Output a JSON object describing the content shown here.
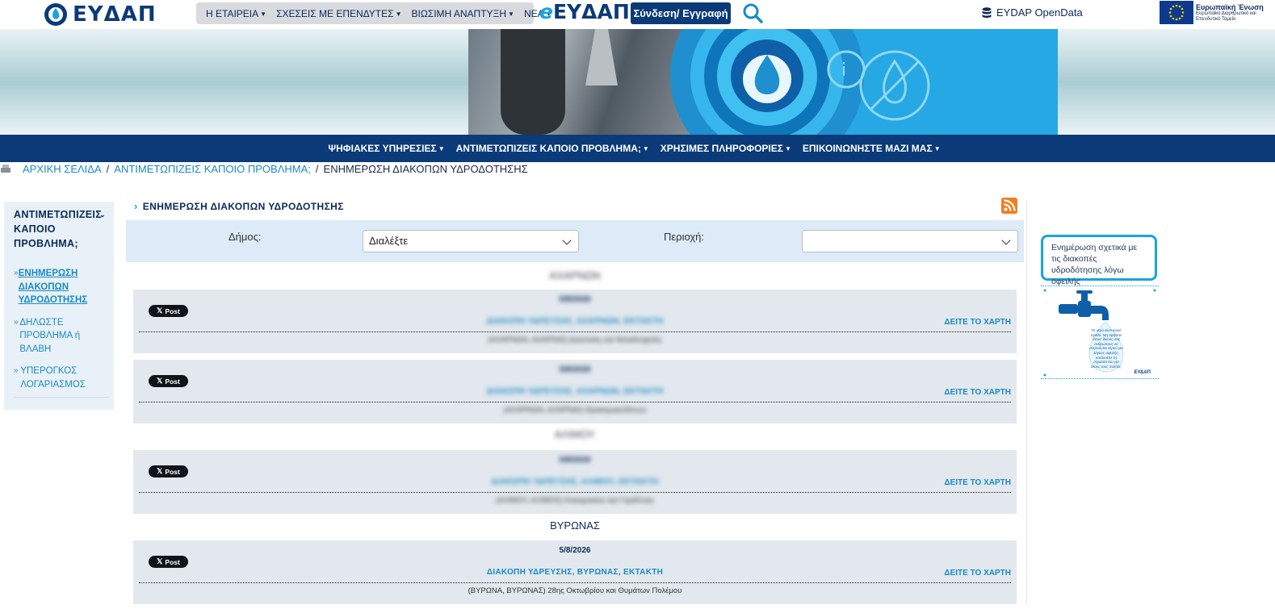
{
  "header": {
    "logo_text": "ΕΥΔΑΠ",
    "top_nav": [
      {
        "label": "Η ΕΤΑΙΡΕΙΑ"
      },
      {
        "label": "ΣΧΕΣΕΙΣ ΜΕ ΕΠΕΝΔΥΤΕΣ"
      },
      {
        "label": "ΒΙΩΣΙΜΗ ΑΝΑΠΤΥΞΗ"
      },
      {
        "label": "ΝΕΑ"
      }
    ],
    "eydap_prefix": "e",
    "eydap_brand": "ΕΥΔΑΠ",
    "login_label": "Σύνδεση/ Εγγραφή",
    "opendata_label": "EYDAP OpenData",
    "eu_title": "Ευρωπαϊκή Ένωση",
    "eu_subtitle": "Ευρωπαϊκό Διαρθρωτικό και Επενδυτικό Ταμείο"
  },
  "main_nav": [
    {
      "label": "ΨΗΦΙΑΚΕΣ ΥΠΗΡΕΣΙΕΣ"
    },
    {
      "label": "ΑΝΤΙΜΕΤΩΠΙΖΕΙΣ ΚΑΠΟΙΟ ΠΡΟΒΛΗΜΑ;"
    },
    {
      "label": "ΧΡΗΣΙΜΕΣ ΠΛΗΡΟΦΟΡΙΕΣ"
    },
    {
      "label": "ΕΠΙΚΟΙΝΩΝΗΣΤΕ ΜΑΖΙ ΜΑΣ"
    }
  ],
  "breadcrumb": {
    "home": "ΑΡΧΙΚΗ ΣΕΛΙΔΑ",
    "parent": "ΑΝΤΙΜΕΤΩΠΙΖΕΙΣ ΚΑΠΟΙΟ ΠΡΟΒΛΗΜΑ;",
    "current": "ΕΝΗΜΕΡΩΣΗ ΔΙΑΚΟΠΩΝ ΥΔΡΟΔΟΤΗΣΗΣ",
    "separator": "/"
  },
  "sidebar": {
    "title": "ΑΝΤΙΜΕΤΩΠΙΖΕΙΣ ΚΑΠΟΙΟ ΠΡΟΒΛΗΜΑ;",
    "items": [
      {
        "label": "ΕΝΗΜΕΡΩΣΗ ΔΙΑΚΟΠΩΝ ΥΔΡΟΔΟΤΗΣΗΣ"
      },
      {
        "label": "ΔΗΛΩΣΤΕ ΠΡΟΒΛΗΜΑ ή ΒΛΑΒΗ"
      },
      {
        "label": "ΥΠΕΡΟΓΚΟΣ ΛΟΓΑΡΙΑΣΜΟΣ"
      }
    ]
  },
  "content": {
    "title": "ΕΝΗΜΕΡΩΣΗ ΔΙΑΚΟΠΩΝ ΥΔΡΟΔΟΤΗΣΗΣ",
    "filters": {
      "municipality_label": "Δήμος:",
      "municipality_value": "Διαλέξτε",
      "area_label": "Περιοχή:",
      "area_value": ""
    },
    "post_label": "Post",
    "map_link_label": "ΔΕΙΤΕ ΤΟ ΧΑΡΤΗ",
    "groups": [
      {
        "name": "ΑΧΑΡΝΩΝ",
        "blurred": true
      },
      {
        "name": "ΑΛΙΜΟΥ",
        "blurred": true
      },
      {
        "name": "ΒΥΡΩΝΑΣ",
        "blurred": false
      }
    ],
    "notices": [
      {
        "date": "5/8/2026",
        "title": "ΔΙΑΚΟΠΗ ΥΔΡΕΥΣΗΣ, ΑΧΑΡΝΩΝ, ΕΚΤΑΚΤΗ",
        "desc": "(ΑΧΑΡΝΩΝ, ΑΧΑΡΝΑΙ) Δεκελείας και Φιλαδελφείας",
        "blurred": true
      },
      {
        "date": "5/8/2026",
        "title": "ΔΙΑΚΟΠΗ ΥΔΡΕΥΣΗΣ, ΑΧΑΡΝΩΝ, ΕΚΤΑΚΤΗ",
        "desc": "(ΑΧΑΡΝΩΝ, ΑΧΑΡΝΑΙ) Θρακομακεδόνων",
        "blurred": true
      },
      {
        "date": "5/8/2026",
        "title": "ΔΙΑΚΟΠΗ ΥΔΡΕΥΣΗΣ, ΑΛΙΜΟΥ, ΕΚΤΑΚΤΗ",
        "desc": "(ΑΛΙΜΟΥ, ΑΛΙΜΟΣ) Καλαμακίου και Γαρδένιας",
        "blurred": true
      },
      {
        "date": "5/8/2026",
        "title": "ΔΙΑΚΟΠΗ ΥΔΡΕΥΣΗΣ, ΒΥΡΩΝΑΣ, ΕΚΤΑΚΤΗ",
        "desc": "(ΒΥΡΩΝΑ, ΒΥΡΩΝΑΣ) 28ης Οκτωβρίου και Θυμάτων Πολέμου",
        "blurred": false
      }
    ]
  },
  "promo": {
    "text": "Ενημέρωση σχετικά με τις διακοπές υδροδότησης λόγω οφειλής",
    "drop_text": "Το νερό είναι κοινό αγαθό. Μη αφήνετε στους δικούς σας ανθρώπους να στερούνται νερού για λόγους οφειλής, κατανοείτε τη σημασία του για όλους τους πολίτες.",
    "brand": "ΕΥΔΑΠ"
  },
  "colors": {
    "navy": "#0b3a78",
    "accent_blue": "#1a8ac6",
    "light_blue": "#1aa3e0",
    "filter_bg": "#dcebf7",
    "card_bg": "#e2e8ed",
    "rss": "#ee7e21"
  }
}
